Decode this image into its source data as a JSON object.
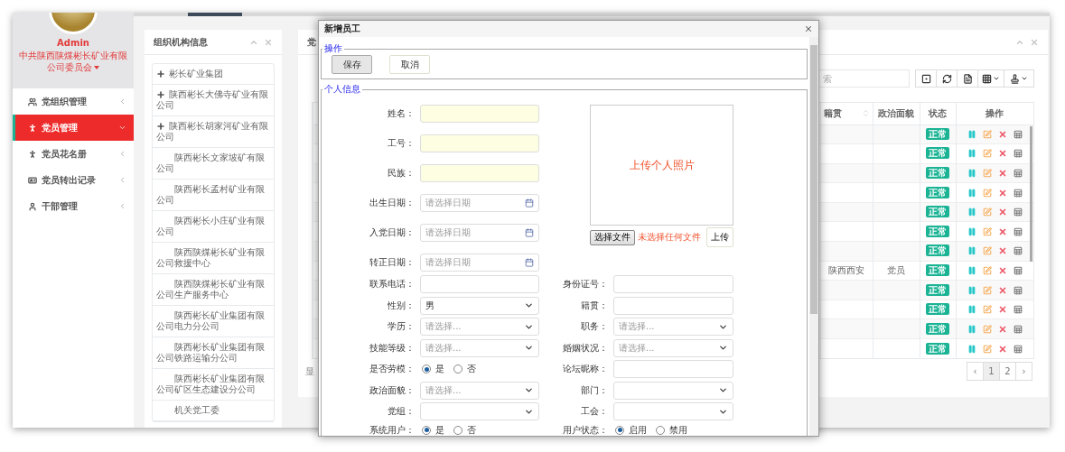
{
  "sidebar": {
    "user": "Admin",
    "org": "中共陕西陕煤彬长矿业有限公司委员会",
    "menu": [
      {
        "label": "党组织管理",
        "selected": false
      },
      {
        "label": "党员管理",
        "selected": true
      },
      {
        "label": "党员花名册",
        "selected": false
      },
      {
        "label": "党员转出记录",
        "selected": false
      },
      {
        "label": "干部管理",
        "selected": false
      }
    ]
  },
  "org_tree": {
    "title": "组织机构信息",
    "items": [
      {
        "label": "彬长矿业集团",
        "expandable": true
      },
      {
        "label": "陕西彬长大佛寺矿业有限公司",
        "expandable": true
      },
      {
        "label": "陕西彬长胡家河矿业有限公司",
        "expandable": true
      },
      {
        "label": "陕西彬长文家坡矿有限公司",
        "expandable": false
      },
      {
        "label": "陕西彬长孟村矿业有限公司",
        "expandable": false
      },
      {
        "label": "陕西彬长小庄矿业有限公司",
        "expandable": false
      },
      {
        "label": "陕西陕煤彬长矿业有限公司救援中心",
        "expandable": false
      },
      {
        "label": "陕西陕煤彬长矿业有限公司生产服务中心",
        "expandable": false
      },
      {
        "label": "陕西彬长矿业集团有限公司电力分公司",
        "expandable": false
      },
      {
        "label": "陕西彬长矿业集团有限公司铁路运输分公司",
        "expandable": false
      },
      {
        "label": "陕西彬长矿业集团有限公司矿区生态建设分公司",
        "expandable": false
      },
      {
        "label": "机关党工委",
        "expandable": false
      }
    ]
  },
  "member_panel": {
    "title": "党",
    "search_placeholder": "索",
    "columns": [
      {
        "label": "籍贯",
        "sortable": true
      },
      {
        "label": "政治面貌",
        "sortable": false
      },
      {
        "label": "状态",
        "sortable": false
      },
      {
        "label": "操作",
        "sortable": false
      }
    ],
    "rows": [
      {
        "status": "正常"
      },
      {
        "status": "正常"
      },
      {
        "status": "正常"
      },
      {
        "status": "正常"
      },
      {
        "status": "正常"
      },
      {
        "status": "正常"
      },
      {
        "status": "正常"
      },
      {
        "native_place": "陕西西安",
        "political_status": "党员",
        "status": "正常"
      },
      {
        "status": "正常"
      },
      {
        "status": "正常"
      },
      {
        "status": "正常"
      },
      {
        "status": "正常"
      }
    ],
    "footer": "显",
    "prev": "‹",
    "next": "›",
    "pages": [
      {
        "label": "1",
        "selected": true
      },
      {
        "label": "2",
        "selected": false
      }
    ]
  },
  "dialog": {
    "title": "新增员工",
    "ops_legend": "操作",
    "buttons": [
      {
        "label": "保存",
        "pressed": true
      },
      {
        "label": "取消",
        "pressed": false
      }
    ],
    "info_legend": "个人信息",
    "upper_fields": [
      {
        "label": "姓名：",
        "kind": "text",
        "highlighted": true
      },
      {
        "label": "工号：",
        "kind": "text",
        "highlighted": true
      },
      {
        "label": "民族：",
        "kind": "text",
        "highlighted": true
      },
      {
        "label": "出生日期：",
        "kind": "date",
        "placeholder": "请选择日期"
      },
      {
        "label": "入党日期：",
        "kind": "date",
        "placeholder": "请选择日期"
      },
      {
        "label": "转正日期：",
        "kind": "date",
        "placeholder": "请选择日期"
      }
    ],
    "photo": {
      "caption": "上传个人照片",
      "choose_button": "选择文件",
      "file_status": "未选择任何文件",
      "upload_button": "上传"
    },
    "rows": [
      {
        "left": {
          "label": "联系电话：",
          "kind": "text",
          "highlighted": false
        },
        "right": {
          "label": "身份证号：",
          "kind": "text",
          "highlighted": false
        }
      },
      {
        "left": {
          "label": "性别：",
          "kind": "select",
          "value": "男"
        },
        "right": {
          "label": "籍贯：",
          "kind": "text",
          "highlighted": false
        }
      },
      {
        "left": {
          "label": "学历：",
          "kind": "select",
          "placeholder": "请选择..."
        },
        "right": {
          "label": "职务：",
          "kind": "select",
          "placeholder": "请选择..."
        }
      },
      {
        "left": {
          "label": "技能等级：",
          "kind": "select",
          "placeholder": "请选择..."
        },
        "right": {
          "label": "婚姻状况：",
          "kind": "select",
          "placeholder": "请选择..."
        }
      },
      {
        "left": {
          "label": "是否劳模：",
          "kind": "radio",
          "options": [
            {
              "label": "是",
              "selected": true
            },
            {
              "label": "否",
              "selected": false
            }
          ]
        },
        "right": {
          "label": "论坛昵称：",
          "kind": "text",
          "highlighted": false
        }
      },
      {
        "left": {
          "label": "政治面貌：",
          "kind": "select",
          "placeholder": "请选择..."
        },
        "right": {
          "label": "部门：",
          "kind": "select"
        }
      },
      {
        "left": {
          "label": "党组：",
          "kind": "select"
        },
        "right": {
          "label": "工会：",
          "kind": "select"
        }
      },
      {
        "left": {
          "label": "系统用户：",
          "kind": "radio",
          "options": [
            {
              "label": "是",
              "selected": true
            },
            {
              "label": "否",
              "selected": false
            }
          ]
        },
        "right": {
          "label": "用户状态：",
          "kind": "radio",
          "options": [
            {
              "label": "启用",
              "selected": true
            },
            {
              "label": "禁用",
              "selected": false
            }
          ]
        }
      }
    ]
  }
}
